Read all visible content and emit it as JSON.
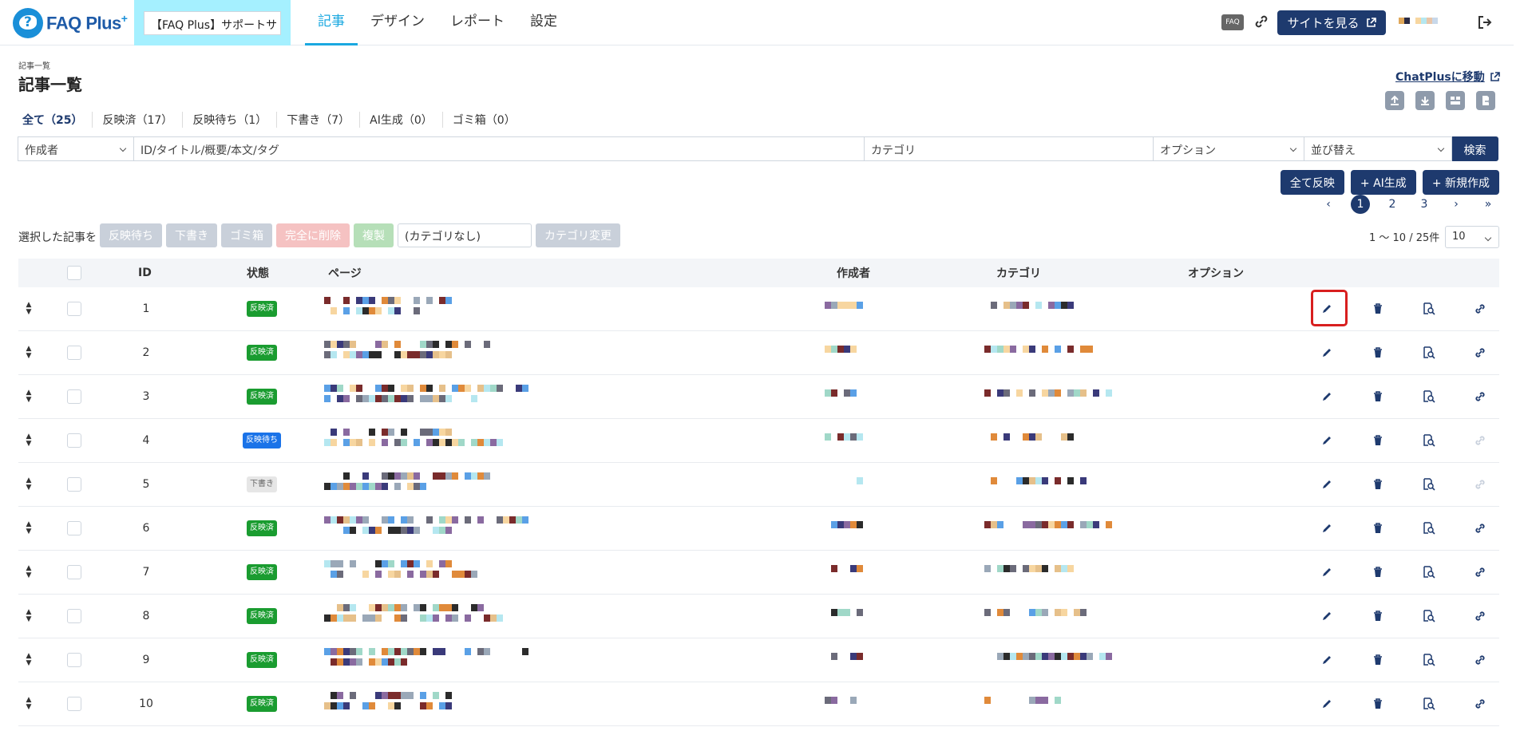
{
  "nav": {
    "logo_text": "FAQ Plus",
    "logo_plus": "+",
    "site_selector": "【FAQ Plus】サポートサ",
    "items": [
      "記事",
      "デザイン",
      "レポート",
      "設定"
    ],
    "faq_badge": "FAQ",
    "view_site_label": "サイトを見る"
  },
  "header": {
    "breadcrumb": "記事一覧",
    "title": "記事一覧",
    "chatplus_link": "ChatPlusに移動"
  },
  "status_tabs": [
    "全て（25）",
    "反映済（17）",
    "反映待ち（1）",
    "下書き（7）",
    "AI生成（0）",
    "ゴミ箱（0）"
  ],
  "search": {
    "author_select": "作成者",
    "keyword_placeholder": "ID/タイトル/概要/本文/タグ",
    "category_placeholder": "カテゴリ",
    "option_select": "オプション",
    "sort_select": "並び替え",
    "search_button": "検索"
  },
  "actions": {
    "publish_all": "全て反映",
    "ai_generate": "+ AI生成",
    "new_create": "+ 新規作成"
  },
  "pagination": {
    "prev": "‹",
    "pages": [
      "1",
      "2",
      "3"
    ],
    "current": "1",
    "next": "›",
    "last": "»",
    "count_text": "1 〜 10 / 25件",
    "per_page": "10"
  },
  "bulk": {
    "label": "選択した記事を",
    "buttons": [
      "反映待ち",
      "下書き",
      "ゴミ箱",
      "完全に削除",
      "複製"
    ],
    "category_select": "(カテゴリなし)",
    "category_change": "カテゴリ変更"
  },
  "table": {
    "headers": {
      "id": "ID",
      "status": "状態",
      "page": "ページ",
      "author": "作成者",
      "category": "カテゴリ",
      "option": "オプション"
    },
    "rows": [
      {
        "id": "1",
        "status": "反映済",
        "status_type": "green"
      },
      {
        "id": "2",
        "status": "反映済",
        "status_type": "green"
      },
      {
        "id": "3",
        "status": "反映済",
        "status_type": "green"
      },
      {
        "id": "4",
        "status": "反映待ち",
        "status_type": "blue"
      },
      {
        "id": "5",
        "status": "下書き",
        "status_type": "gray"
      },
      {
        "id": "6",
        "status": "反映済",
        "status_type": "green"
      },
      {
        "id": "7",
        "status": "反映済",
        "status_type": "green"
      },
      {
        "id": "8",
        "status": "反映済",
        "status_type": "green"
      },
      {
        "id": "9",
        "status": "反映済",
        "status_type": "green"
      },
      {
        "id": "10",
        "status": "反映済",
        "status_type": "green"
      }
    ]
  },
  "colors": {
    "navy": "#1e3a6e",
    "accent": "#1aa8e0",
    "published": "#1a9c30",
    "pending": "#1a73e8",
    "highlight": "#d81f1f"
  }
}
